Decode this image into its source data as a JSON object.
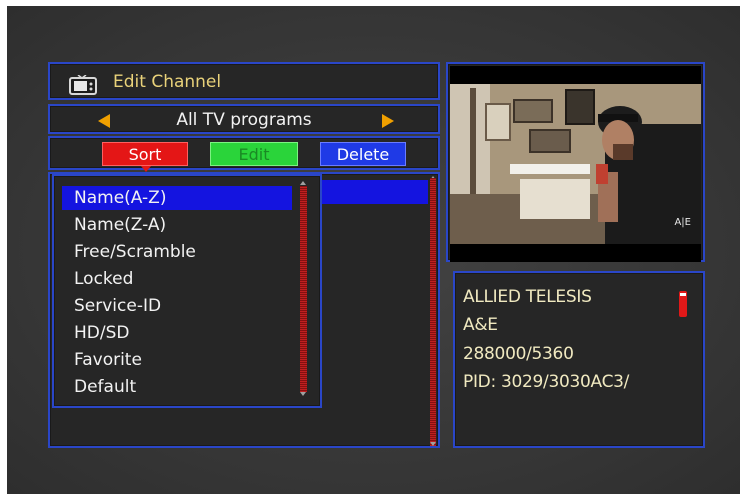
{
  "header": {
    "title": "Edit Channel",
    "icon": "tv-icon"
  },
  "group": {
    "label": "All TV programs"
  },
  "actions": {
    "sort": "Sort",
    "edit": "Edit",
    "delete": "Delete"
  },
  "sort_menu": {
    "items": [
      "Name(A-Z)",
      "Name(Z-A)",
      "Free/Scramble",
      "Locked",
      "Service-ID",
      "HD/SD",
      "Favorite",
      "Default"
    ],
    "selected": "Name(A-Z)"
  },
  "info": {
    "satellite": "ALLIED TELESIS",
    "channel": "A&E",
    "frequency": "288000/5360",
    "pid": "PID: 3029/3030AC3/"
  },
  "preview": {
    "watermark": "A|E"
  },
  "colors": {
    "border": "#2a46c8",
    "sort": "#e41616",
    "edit": "#2ad43a",
    "delete": "#1f3ae6",
    "highlight": "#1414e0",
    "title": "#e9d27a"
  }
}
